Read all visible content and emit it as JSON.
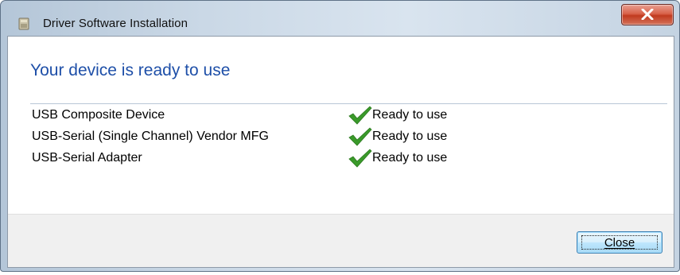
{
  "window": {
    "title": "Driver Software Installation",
    "icon": "driver-install-icon"
  },
  "titlebar": {
    "close_icon": "close-icon",
    "close_color": "#c7432a"
  },
  "content": {
    "heading": "Your device is ready to use",
    "heading_color": "#1e4fa8",
    "devices": [
      {
        "name": "USB Composite Device",
        "status": "Ready to use",
        "status_icon": "checkmark-icon"
      },
      {
        "name": "USB-Serial (Single Channel) Vendor MFG",
        "status": "Ready to use",
        "status_icon": "checkmark-icon"
      },
      {
        "name": "USB-Serial Adapter",
        "status": "Ready to use",
        "status_icon": "checkmark-icon"
      }
    ],
    "check_color": "#3a9a2a"
  },
  "footer": {
    "close_label": "Close"
  }
}
